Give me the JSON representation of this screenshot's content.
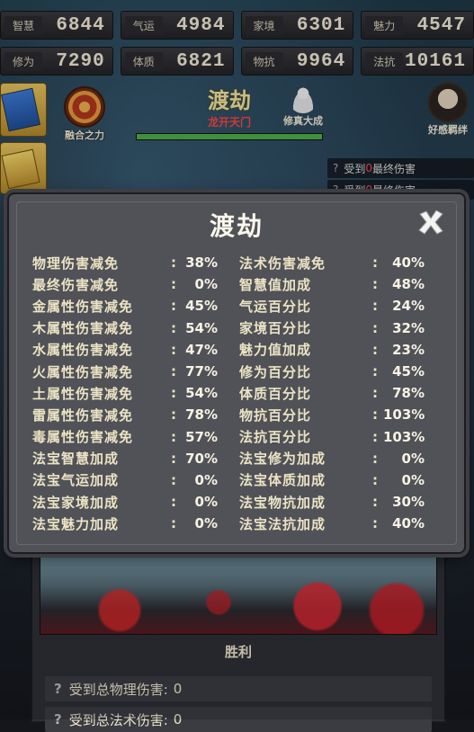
{
  "stats": {
    "row1": [
      {
        "name": "智慧",
        "value": "6844"
      },
      {
        "name": "气运",
        "value": "4984"
      },
      {
        "name": "家境",
        "value": "6301"
      },
      {
        "name": "魅力",
        "value": "4547"
      }
    ],
    "row2": [
      {
        "name": "修为",
        "value": "7290"
      },
      {
        "name": "体质",
        "value": "6821"
      },
      {
        "name": "物抗",
        "value": "9964"
      },
      {
        "name": "法抗",
        "value": "10161"
      }
    ]
  },
  "header": {
    "merge_label": "融合之力",
    "title": "渡劫",
    "subtitle": "龙开天门",
    "progress_percent": 100,
    "cultivate_label": "修真大成",
    "friend_label": "好感羁绊",
    "log": [
      {
        "prefix": "受到",
        "number": "0",
        "suffix": "最终伤害"
      },
      {
        "prefix": "受到",
        "number": "0",
        "suffix": "最终伤害"
      }
    ]
  },
  "modal": {
    "title": "渡劫",
    "rows": [
      [
        {
          "label": "物理伤害减免",
          "value": "38%"
        },
        {
          "label": "法术伤害减免",
          "value": "40%"
        }
      ],
      [
        {
          "label": "最终伤害减免",
          "value": "0%"
        },
        {
          "label": "智慧值加成",
          "value": "48%"
        }
      ],
      [
        {
          "label": "金属性伤害减免",
          "value": "45%"
        },
        {
          "label": "气运百分比",
          "value": "24%"
        }
      ],
      [
        {
          "label": "木属性伤害减免",
          "value": "54%"
        },
        {
          "label": "家境百分比",
          "value": "32%"
        }
      ],
      [
        {
          "label": "水属性伤害减免",
          "value": "47%"
        },
        {
          "label": "魅力值加成",
          "value": "23%"
        }
      ],
      [
        {
          "label": "火属性伤害减免",
          "value": "77%"
        },
        {
          "label": "修为百分比",
          "value": "45%"
        }
      ],
      [
        {
          "label": "土属性伤害减免",
          "value": "54%"
        },
        {
          "label": "体质百分比",
          "value": "78%"
        }
      ],
      [
        {
          "label": "雷属性伤害减免",
          "value": "78%"
        },
        {
          "label": "物抗百分比",
          "value": "103%"
        }
      ],
      [
        {
          "label": "毒属性伤害减免",
          "value": "57%"
        },
        {
          "label": "法抗百分比",
          "value": "103%"
        }
      ],
      [
        {
          "label": "法宝智慧加成",
          "value": "70%"
        },
        {
          "label": "法宝修为加成",
          "value": "0%"
        }
      ],
      [
        {
          "label": "法宝气运加成",
          "value": "0%"
        },
        {
          "label": "法宝体质加成",
          "value": "0%"
        }
      ],
      [
        {
          "label": "法宝家境加成",
          "value": "0%"
        },
        {
          "label": "法宝物抗加成",
          "value": "30%"
        }
      ],
      [
        {
          "label": "法宝魅力加成",
          "value": "0%"
        },
        {
          "label": "法宝法抗加成",
          "value": "40%"
        }
      ]
    ],
    "colon": ":"
  },
  "result": {
    "victory": "胜利",
    "damage_rows": [
      {
        "label": "受到总物理伤害:",
        "value": "0"
      },
      {
        "label": "受到总法术伤害:",
        "value": "0"
      }
    ],
    "help_glyph": "?"
  },
  "colors": {
    "modal_bg": "#505257",
    "subtitle_red": "#ff4640",
    "progress_green": "#4eb04a"
  }
}
